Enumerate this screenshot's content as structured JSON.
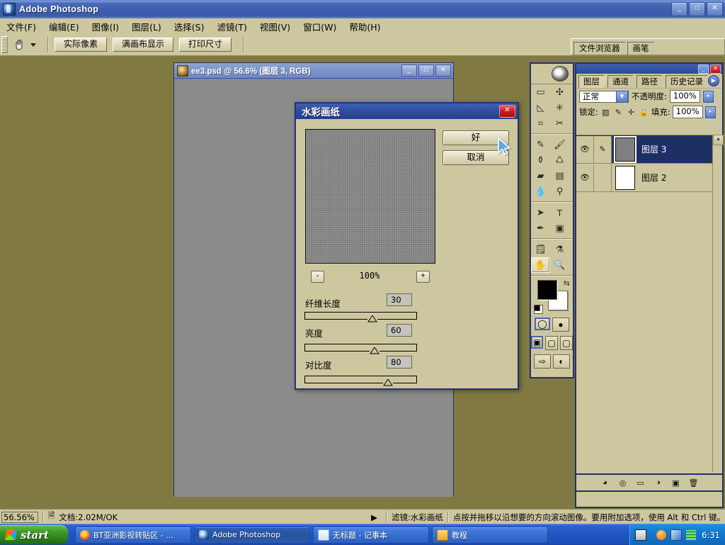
{
  "window": {
    "title": "Adobe Photoshop",
    "minimize": "_",
    "maximize": "□",
    "close": "✕"
  },
  "menubar": [
    {
      "label": "文件(F)",
      "key": "F"
    },
    {
      "label": "编辑(E)",
      "key": "E"
    },
    {
      "label": "图像(I)",
      "key": "I"
    },
    {
      "label": "图层(L)",
      "key": "L"
    },
    {
      "label": "选择(S)",
      "key": "S"
    },
    {
      "label": "滤镜(T)",
      "key": "T"
    },
    {
      "label": "视图(V)",
      "key": "V"
    },
    {
      "label": "窗口(W)",
      "key": "W"
    },
    {
      "label": "帮助(H)",
      "key": "H"
    }
  ],
  "options_bar": {
    "tool_icon": "hand-tool-icon",
    "buttons": [
      "实际像素",
      "满画布显示",
      "打印尺寸"
    ]
  },
  "palette_well": {
    "tabs": [
      "文件浏览器",
      "画笔"
    ]
  },
  "document": {
    "title": "ee3.psd @ 56.6% (图层 3, RGB)",
    "minimize": "_",
    "maximize": "□",
    "close": "✕",
    "canvas_color": "#8b8b8b"
  },
  "dialog": {
    "title": "水彩画纸",
    "close": "✕",
    "ok_label": "好",
    "cancel_label": "取消",
    "zoom_level": "100%",
    "zoom_out": "-",
    "zoom_in": "+",
    "sliders": [
      {
        "label": "纤维长度",
        "value": "30",
        "pct": 30
      },
      {
        "label": "亮度",
        "value": "60",
        "pct": 60
      },
      {
        "label": "对比度",
        "value": "80",
        "pct": 80
      }
    ]
  },
  "toolbox": {
    "tools": [
      "marquee-tool-icon",
      "move-tool-icon",
      "lasso-tool-icon",
      "magic-wand-tool-icon",
      "crop-tool-icon",
      "slice-tool-icon",
      "healing-brush-icon",
      "brush-tool-icon",
      "clone-stamp-icon",
      "history-brush-icon",
      "eraser-tool-icon",
      "gradient-tool-icon",
      "blur-tool-icon",
      "dodge-tool-icon",
      "path-selection-icon",
      "type-tool-icon",
      "pen-tool-icon",
      "shape-tool-icon",
      "notes-tool-icon",
      "eyedropper-tool-icon",
      "hand-tool-icon",
      "zoom-tool-icon"
    ],
    "foreground_color": "#000000",
    "background_color": "#ffffff",
    "swap_icon": "swap-colors-icon",
    "default_icon": "default-colors-icon",
    "quickmask": [
      "standard-mode-icon",
      "quickmask-mode-icon"
    ],
    "screenmode": [
      "standard-screen-icon",
      "fullscreen-menubar-icon",
      "fullscreen-icon"
    ],
    "jumpto": [
      "jump-to-imageready-icon",
      "image-preview-icon"
    ]
  },
  "layers_panel": {
    "minimize": "_",
    "close": "✕",
    "tabs": [
      "图层",
      "通道",
      "路径",
      "历史记录"
    ],
    "active_tab": "图层",
    "menu_arrow": "▶",
    "blend_mode": "正常",
    "opacity_label": "不透明度:",
    "opacity_value": "100%",
    "lock_label": "锁定:",
    "lock_icons": [
      "lock-transparent-icon",
      "lock-image-icon",
      "lock-position-icon",
      "lock-all-icon"
    ],
    "fill_label": "填充:",
    "fill_value": "100%",
    "layers": [
      {
        "name": "图层 3",
        "visible": true,
        "selected": true,
        "has_brush": true,
        "thumb_color": "#808080"
      },
      {
        "name": "图层 2",
        "visible": true,
        "selected": false,
        "has_brush": false,
        "thumb_color": "#ffffff"
      }
    ],
    "bottom_buttons": [
      "layer-style-icon",
      "layer-mask-icon",
      "new-group-icon",
      "adjustment-layer-icon",
      "new-layer-icon",
      "delete-layer-icon"
    ]
  },
  "statusbar": {
    "zoom": "56.56%",
    "doc_icon": "document-icon",
    "doc_info": "文档:2.02M/OK",
    "arrow": "▶",
    "filter_info": "滤镜:水彩画纸",
    "hint": "点按并拖移以沿想要的方向滚动图像。要用附加选项，使用 Alt 和 Ctrl 键。"
  },
  "taskbar": {
    "start_label": "start",
    "buttons": [
      {
        "label": "BT亚洲影视转贴区 - ...",
        "icon": "firefox-icon",
        "active": false
      },
      {
        "label": "Adobe Photoshop",
        "icon": "photoshop-icon",
        "active": true
      },
      {
        "label": "无标题 - 记事本",
        "icon": "notepad-icon",
        "active": false
      },
      {
        "label": "教程",
        "icon": "folder-icon",
        "active": false
      }
    ],
    "tray_icons": [
      "keyboard-layout-icon",
      "shield-icon",
      "network-icon",
      "grid-icon"
    ],
    "clock": "6:31"
  },
  "colors": {
    "desktop": "#807a42",
    "palette_bg": "#cdc7a0",
    "title_blue": "#2f4ea0",
    "selection_blue": "#1e2f66"
  }
}
